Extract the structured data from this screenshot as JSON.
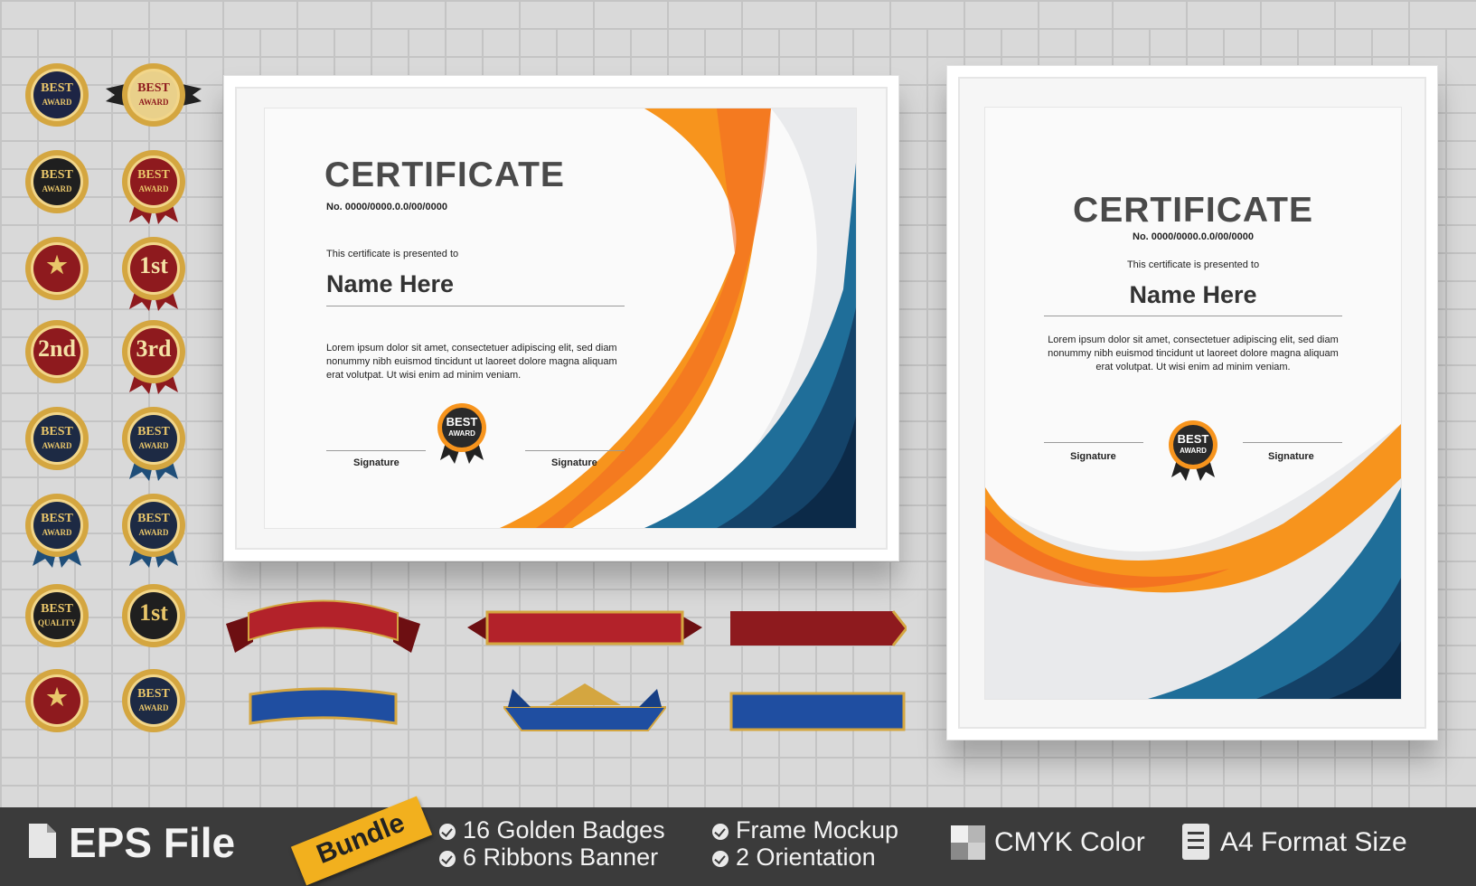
{
  "badges": [
    {
      "line1": "BEST",
      "line2": "AWARD"
    },
    {
      "line1": "BEST",
      "line2": "AWARD"
    },
    {
      "line1": "BEST",
      "line2": "AWARD"
    },
    {
      "line1": "BEST",
      "line2": "AWARD"
    },
    {
      "line1": "★",
      "line2": ""
    },
    {
      "line1": "1st",
      "line2": ""
    },
    {
      "line1": "2nd",
      "line2": ""
    },
    {
      "line1": "3rd",
      "line2": ""
    },
    {
      "line1": "BEST",
      "line2": "AWARD"
    },
    {
      "line1": "BEST",
      "line2": "AWARD"
    },
    {
      "line1": "BEST",
      "line2": "AWARD"
    },
    {
      "line1": "BEST",
      "line2": "AWARD"
    },
    {
      "line1": "BEST",
      "line2": "QUALITY"
    },
    {
      "line1": "1st",
      "line2": ""
    },
    {
      "line1": "★",
      "line2": ""
    },
    {
      "line1": "BEST",
      "line2": "AWARD"
    }
  ],
  "certificate_landscape": {
    "title": "CERTIFICATE",
    "number": "No. 0000/0000.0.0/00/0000",
    "presented": "This certificate is presented to",
    "name": "Name Here",
    "body": "Lorem ipsum dolor sit amet, consectetuer adipiscing elit, sed diam nonummy nibh euismod tincidunt ut laoreet dolore magna aliquam erat volutpat. Ut wisi enim ad minim veniam.",
    "signature_left": "Signature",
    "signature_right": "Signature",
    "seal_line1": "BEST",
    "seal_line2": "AWARD"
  },
  "certificate_portrait": {
    "title": "CERTIFICATE",
    "number": "No. 0000/0000.0.0/00/0000",
    "presented": "This certificate is presented to",
    "name": "Name Here",
    "body": "Lorem ipsum dolor sit amet, consectetuer adipiscing elit, sed diam nonummy nibh euismod tincidunt ut laoreet dolore magna aliquam erat volutpat. Ut wisi enim ad minim veniam.",
    "signature_left": "Signature",
    "signature_right": "Signature",
    "seal_line1": "BEST",
    "seal_line2": "AWARD"
  },
  "bar": {
    "file_label": "EPS File",
    "bundle_label": "Bundle",
    "feature_1": "16 Golden Badges",
    "feature_2": "6  Ribbons Banner",
    "feature_3": "Frame Mockup",
    "feature_4": "2 Orientation",
    "feature_5": "CMYK Color",
    "feature_6": "A4 Format Size"
  },
  "colors": {
    "orange": "#f7941d",
    "orange_dark": "#f26522",
    "blue": "#1f6e99",
    "navy": "#12365a",
    "gold": "#d4a640",
    "red": "#9e1b1f",
    "wall": "#d9d9d9",
    "bar": "#3b3b3b"
  }
}
